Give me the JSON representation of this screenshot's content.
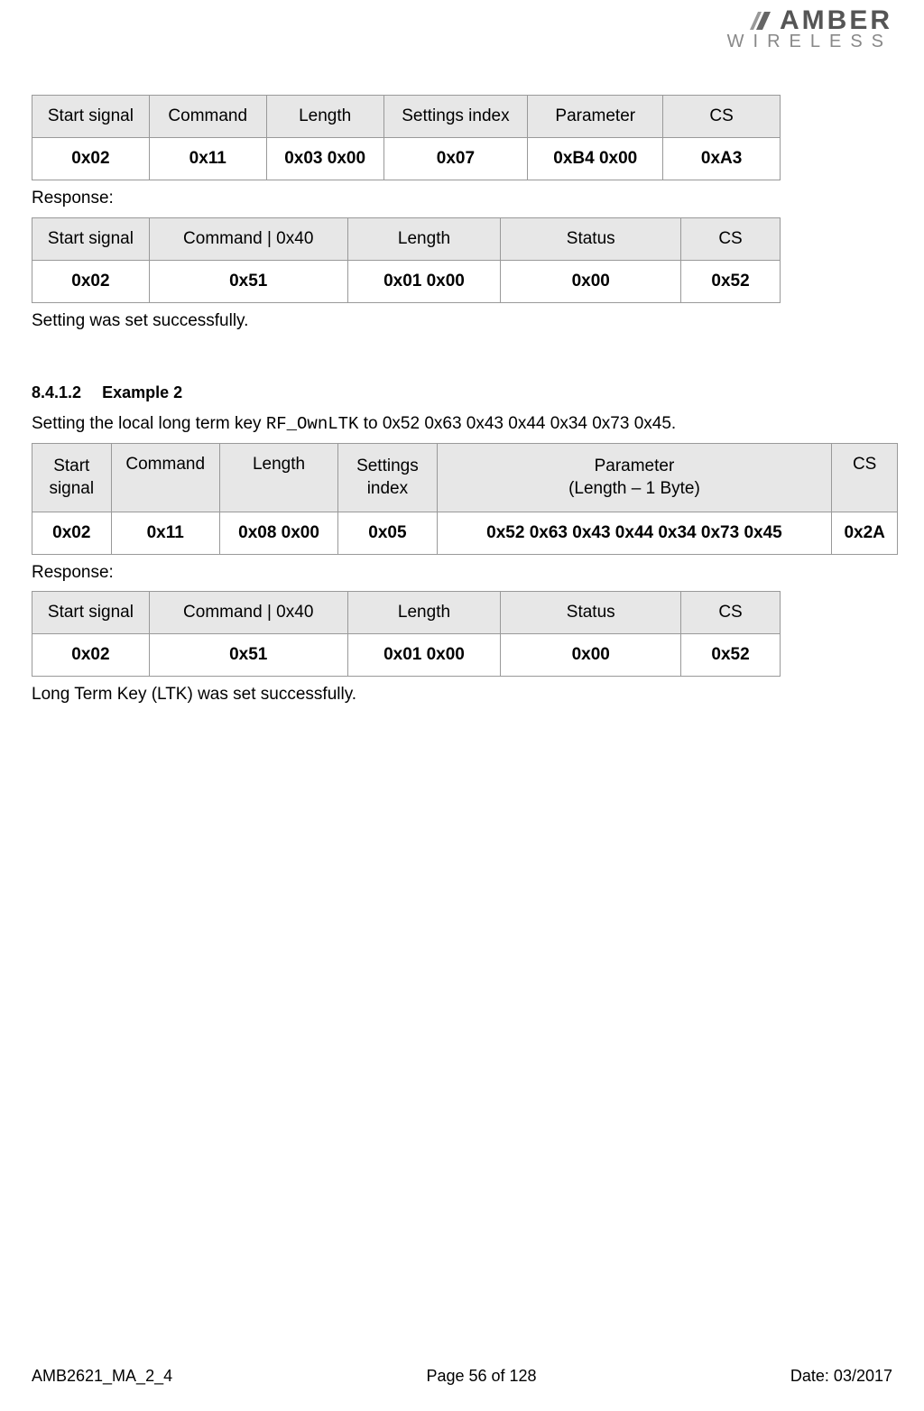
{
  "logo": {
    "line1": "AMBER",
    "line2": "WIRELESS"
  },
  "table1": {
    "headers": [
      "Start signal",
      "Command",
      "Length",
      "Settings index",
      "Parameter",
      "CS"
    ],
    "values": [
      "0x02",
      "0x11",
      "0x03 0x00",
      "0x07",
      "0xB4 0x00",
      "0xA3"
    ]
  },
  "text_response": "Response:",
  "table2": {
    "headers": [
      "Start signal",
      "Command | 0x40",
      "Length",
      "Status",
      "CS"
    ],
    "values": [
      "0x02",
      "0x51",
      "0x01 0x00",
      "0x00",
      "0x52"
    ]
  },
  "text_success1": "Setting was set successfully.",
  "section": {
    "number": "8.4.1.2",
    "title": "Example 2"
  },
  "text_setting_intro_pre": "Setting the local long term key ",
  "text_setting_code": "RF_OwnLTK",
  "text_setting_intro_post": " to 0x52 0x63 0x43 0x44 0x34 0x73 0x45.",
  "table3": {
    "headers": {
      "c1": "Start signal",
      "c2": "Command",
      "c3": "Length",
      "c4": "Settings index",
      "c5a": "Parameter",
      "c5b": "(Length – 1 Byte)",
      "c6": "CS"
    },
    "values": [
      "0x02",
      "0x11",
      "0x08 0x00",
      "0x05",
      "0x52 0x63 0x43 0x44 0x34 0x73 0x45",
      "0x2A"
    ]
  },
  "table4": {
    "headers": [
      "Start signal",
      "Command | 0x40",
      "Length",
      "Status",
      "CS"
    ],
    "values": [
      "0x02",
      "0x51",
      "0x01 0x00",
      "0x00",
      "0x52"
    ]
  },
  "text_success2": "Long Term Key (LTK) was set successfully.",
  "footer": {
    "left": "AMB2621_MA_2_4",
    "center": "Page 56 of 128",
    "right": "Date: 03/2017"
  }
}
